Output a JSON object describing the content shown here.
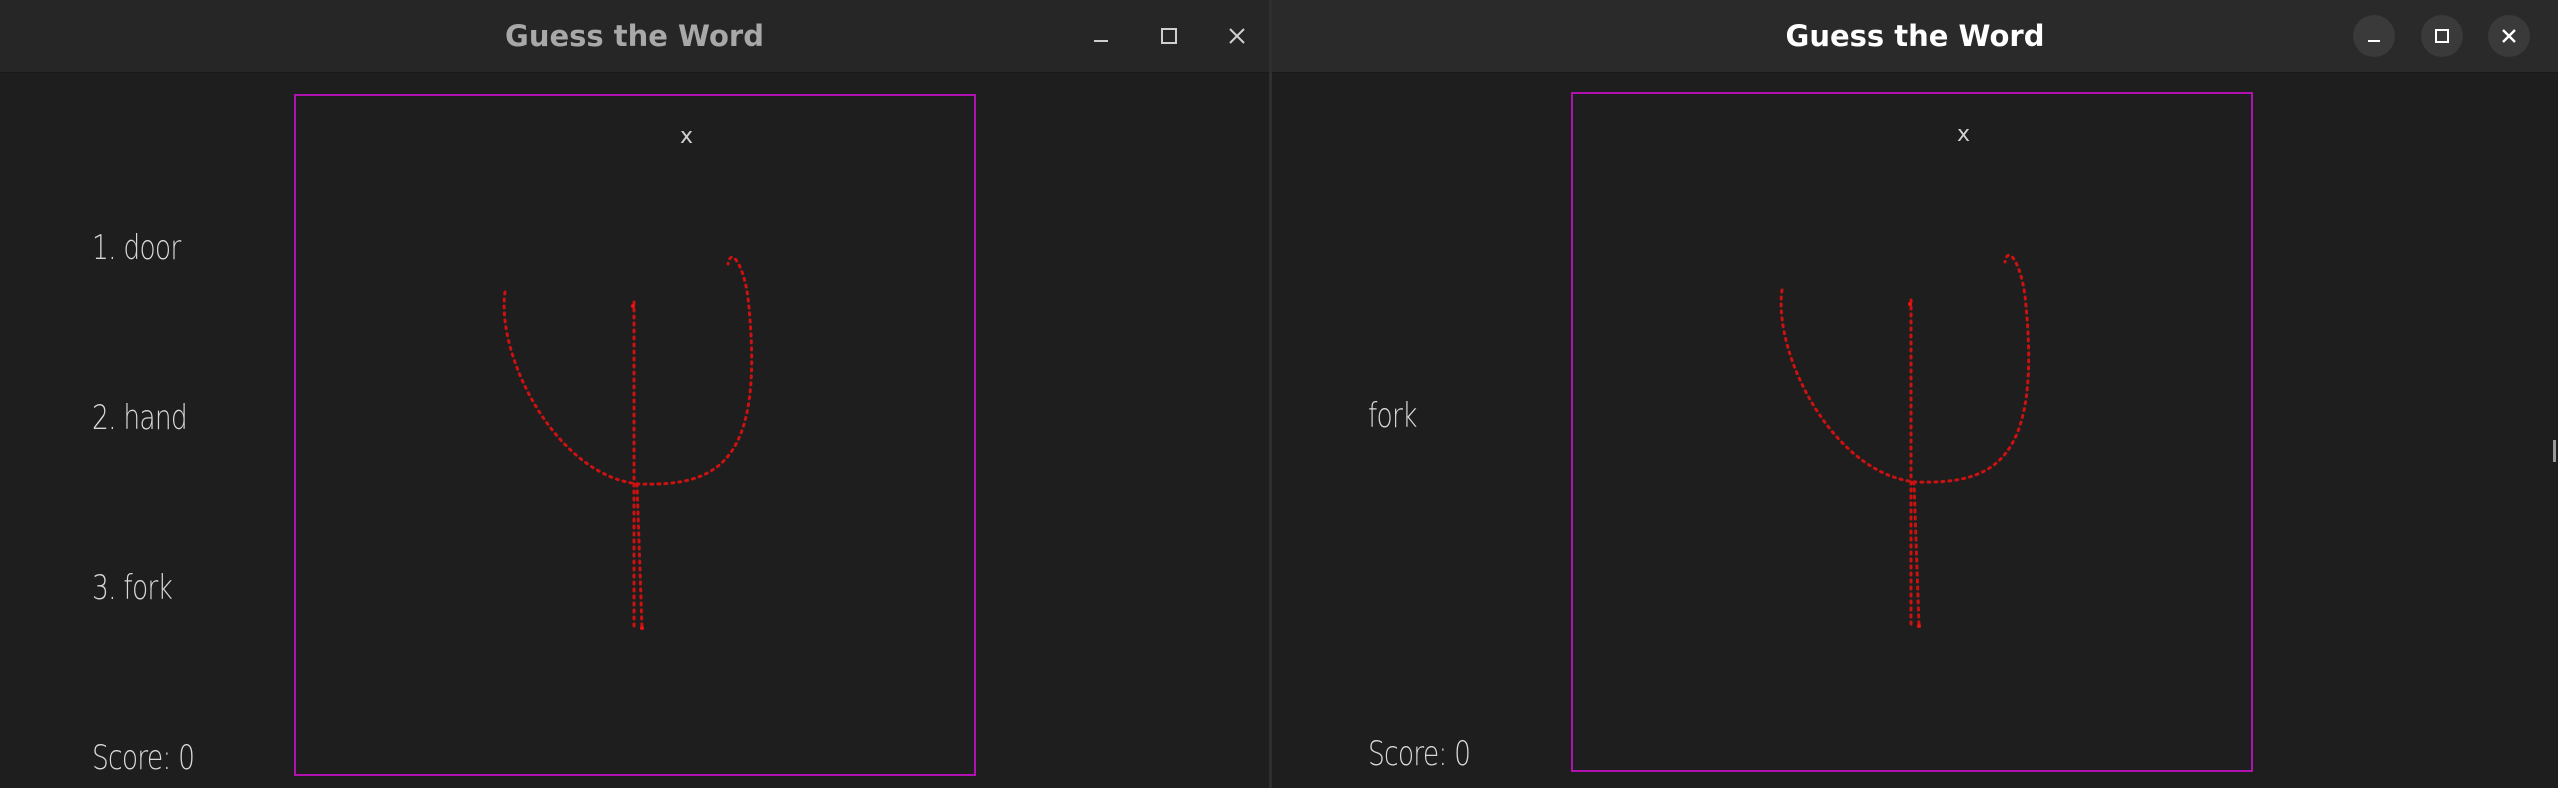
{
  "left_window": {
    "title": "Guess the Word",
    "options": [
      "1. door",
      "2. hand",
      "3. fork"
    ],
    "score": "Score: 0",
    "canvas_marker": "x"
  },
  "right_window": {
    "title": "Guess the Word",
    "guess": "fork",
    "score": "Score: 0",
    "canvas_marker": "x"
  },
  "colors": {
    "canvas_border": "#b012b0",
    "stroke": "#cc1111",
    "background": "#1e1e1e"
  },
  "icons": [
    "minimize-icon",
    "maximize-icon",
    "close-icon"
  ]
}
